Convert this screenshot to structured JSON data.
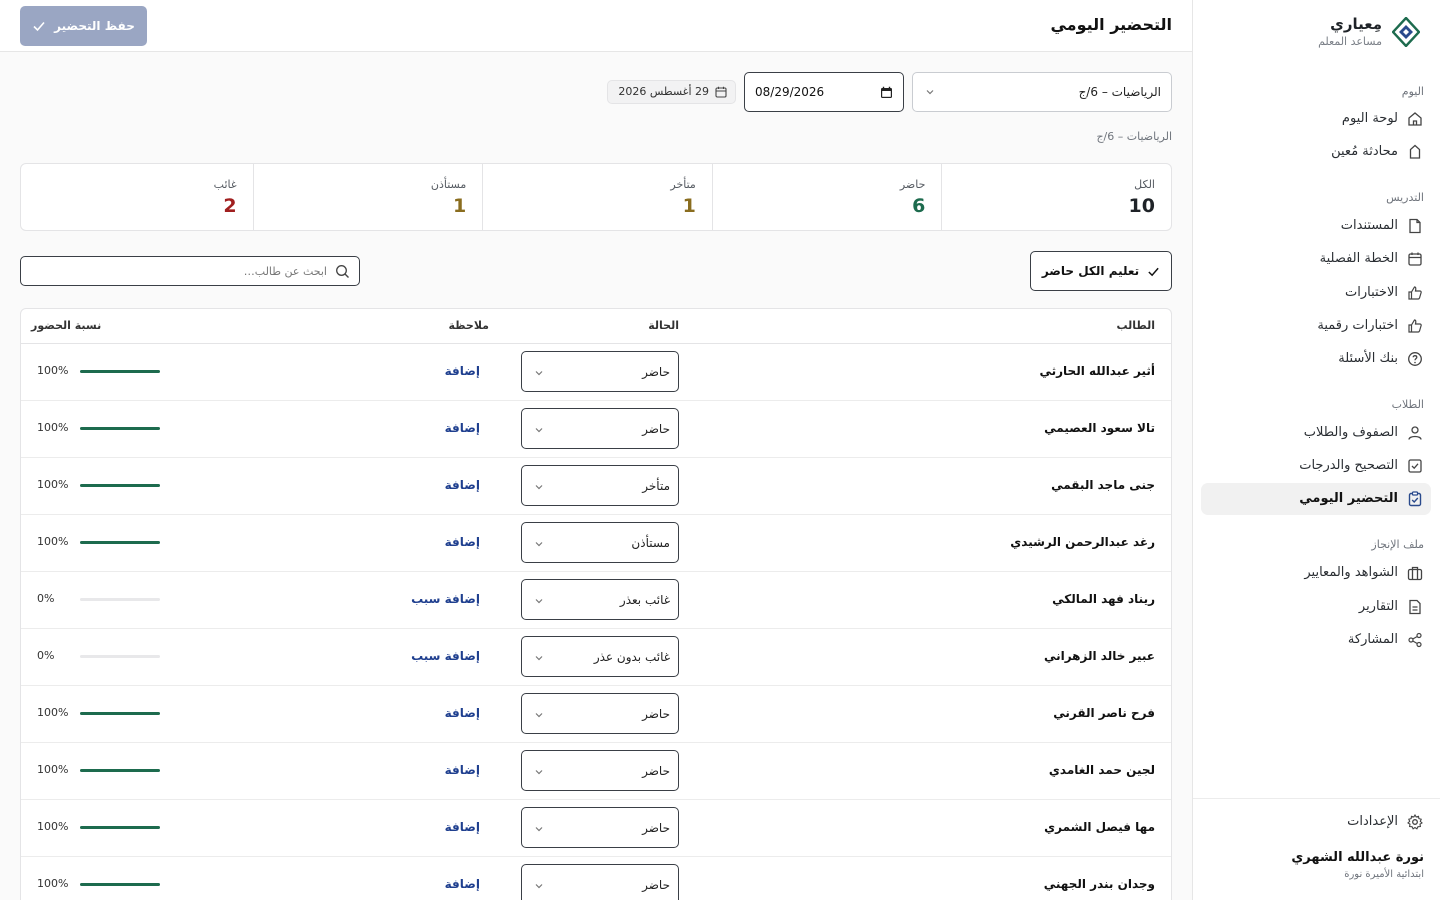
{
  "brand": {
    "name": "مِعياري",
    "subtitle": "مساعد المعلم"
  },
  "sidebar": {
    "sections": [
      {
        "title": "اليوم",
        "items": [
          {
            "label": "لوحة اليوم",
            "icon": "home-icon"
          },
          {
            "label": "محادثة مُعين",
            "icon": "chat-icon"
          }
        ]
      },
      {
        "title": "التدريس",
        "items": [
          {
            "label": "المستندات",
            "icon": "document-icon"
          },
          {
            "label": "الخطة الفصلية",
            "icon": "calendar-icon"
          },
          {
            "label": "الاختبارات",
            "icon": "thumb-icon"
          },
          {
            "label": "اختبارات رقمية",
            "icon": "thumb-icon"
          },
          {
            "label": "بنك الأسئلة",
            "icon": "question-icon"
          }
        ]
      },
      {
        "title": "الطلاب",
        "items": [
          {
            "label": "الصفوف والطلاب",
            "icon": "user-icon"
          },
          {
            "label": "التصحيح والدرجات",
            "icon": "check-square-icon"
          },
          {
            "label": "التحضير اليومي",
            "icon": "clipboard-icon",
            "active": true
          }
        ]
      },
      {
        "title": "ملف الإنجاز",
        "items": [
          {
            "label": "الشواهد والمعايير",
            "icon": "briefcase-icon"
          },
          {
            "label": "التقارير",
            "icon": "report-icon"
          },
          {
            "label": "المشاركة",
            "icon": "share-icon"
          }
        ]
      }
    ],
    "settings_label": "الإعدادات",
    "user": {
      "name": "نورة عبدالله الشهري",
      "school": "ابتدائية الأميرة نورة"
    }
  },
  "header": {
    "title": "التحضير اليومي",
    "save_label": "حفظ التحضير"
  },
  "filters": {
    "class_value": "الرياضيات – 6/ج",
    "date_value": "08/29/2026",
    "date_display": "29 أغسطس 2026",
    "class_caption": "الرياضيات – 6/ج"
  },
  "stats": [
    {
      "label": "الكل",
      "value": "10",
      "color": "#1f2328"
    },
    {
      "label": "حاضر",
      "value": "6",
      "color": "#1d6b4e"
    },
    {
      "label": "متأخر",
      "value": "1",
      "color": "#8a6d1f"
    },
    {
      "label": "مستأذن",
      "value": "1",
      "color": "#8a6d1f"
    },
    {
      "label": "غائب",
      "value": "2",
      "color": "#a01f1f"
    }
  ],
  "actions": {
    "mark_all_label": "تعليم الكل حاضر",
    "search_placeholder": "ابحث عن طالب…"
  },
  "table": {
    "headers": {
      "student": "الطالب",
      "status": "الحالة",
      "note": "ملاحظة",
      "attendance": "نسبة الحضور"
    },
    "rows": [
      {
        "name": "أثير عبدالله الحارثي",
        "status": "حاضر",
        "note": "إضافة",
        "pct": "100%",
        "fill": 100
      },
      {
        "name": "تالا سعود العصيمي",
        "status": "حاضر",
        "note": "إضافة",
        "pct": "100%",
        "fill": 100
      },
      {
        "name": "جنى ماجد البقمي",
        "status": "متأخر",
        "note": "إضافة",
        "pct": "100%",
        "fill": 100
      },
      {
        "name": "رغد عبدالرحمن الرشيدي",
        "status": "مستأذن",
        "note": "إضافة",
        "pct": "100%",
        "fill": 100
      },
      {
        "name": "ريناد فهد المالكي",
        "status": "غائب بعذر",
        "note": "إضافة سبب",
        "pct": "0%",
        "fill": 0
      },
      {
        "name": "عبير خالد الزهراني",
        "status": "غائب بدون عذر",
        "note": "إضافة سبب",
        "pct": "0%",
        "fill": 0
      },
      {
        "name": "فرح ناصر القرني",
        "status": "حاضر",
        "note": "إضافة",
        "pct": "100%",
        "fill": 100
      },
      {
        "name": "لجين حمد الغامدي",
        "status": "حاضر",
        "note": "إضافة",
        "pct": "100%",
        "fill": 100
      },
      {
        "name": "مها فيصل الشمري",
        "status": "حاضر",
        "note": "إضافة",
        "pct": "100%",
        "fill": 100
      },
      {
        "name": "وجدان بندر الجهني",
        "status": "حاضر",
        "note": "إضافة",
        "pct": "100%",
        "fill": 100
      }
    ]
  }
}
